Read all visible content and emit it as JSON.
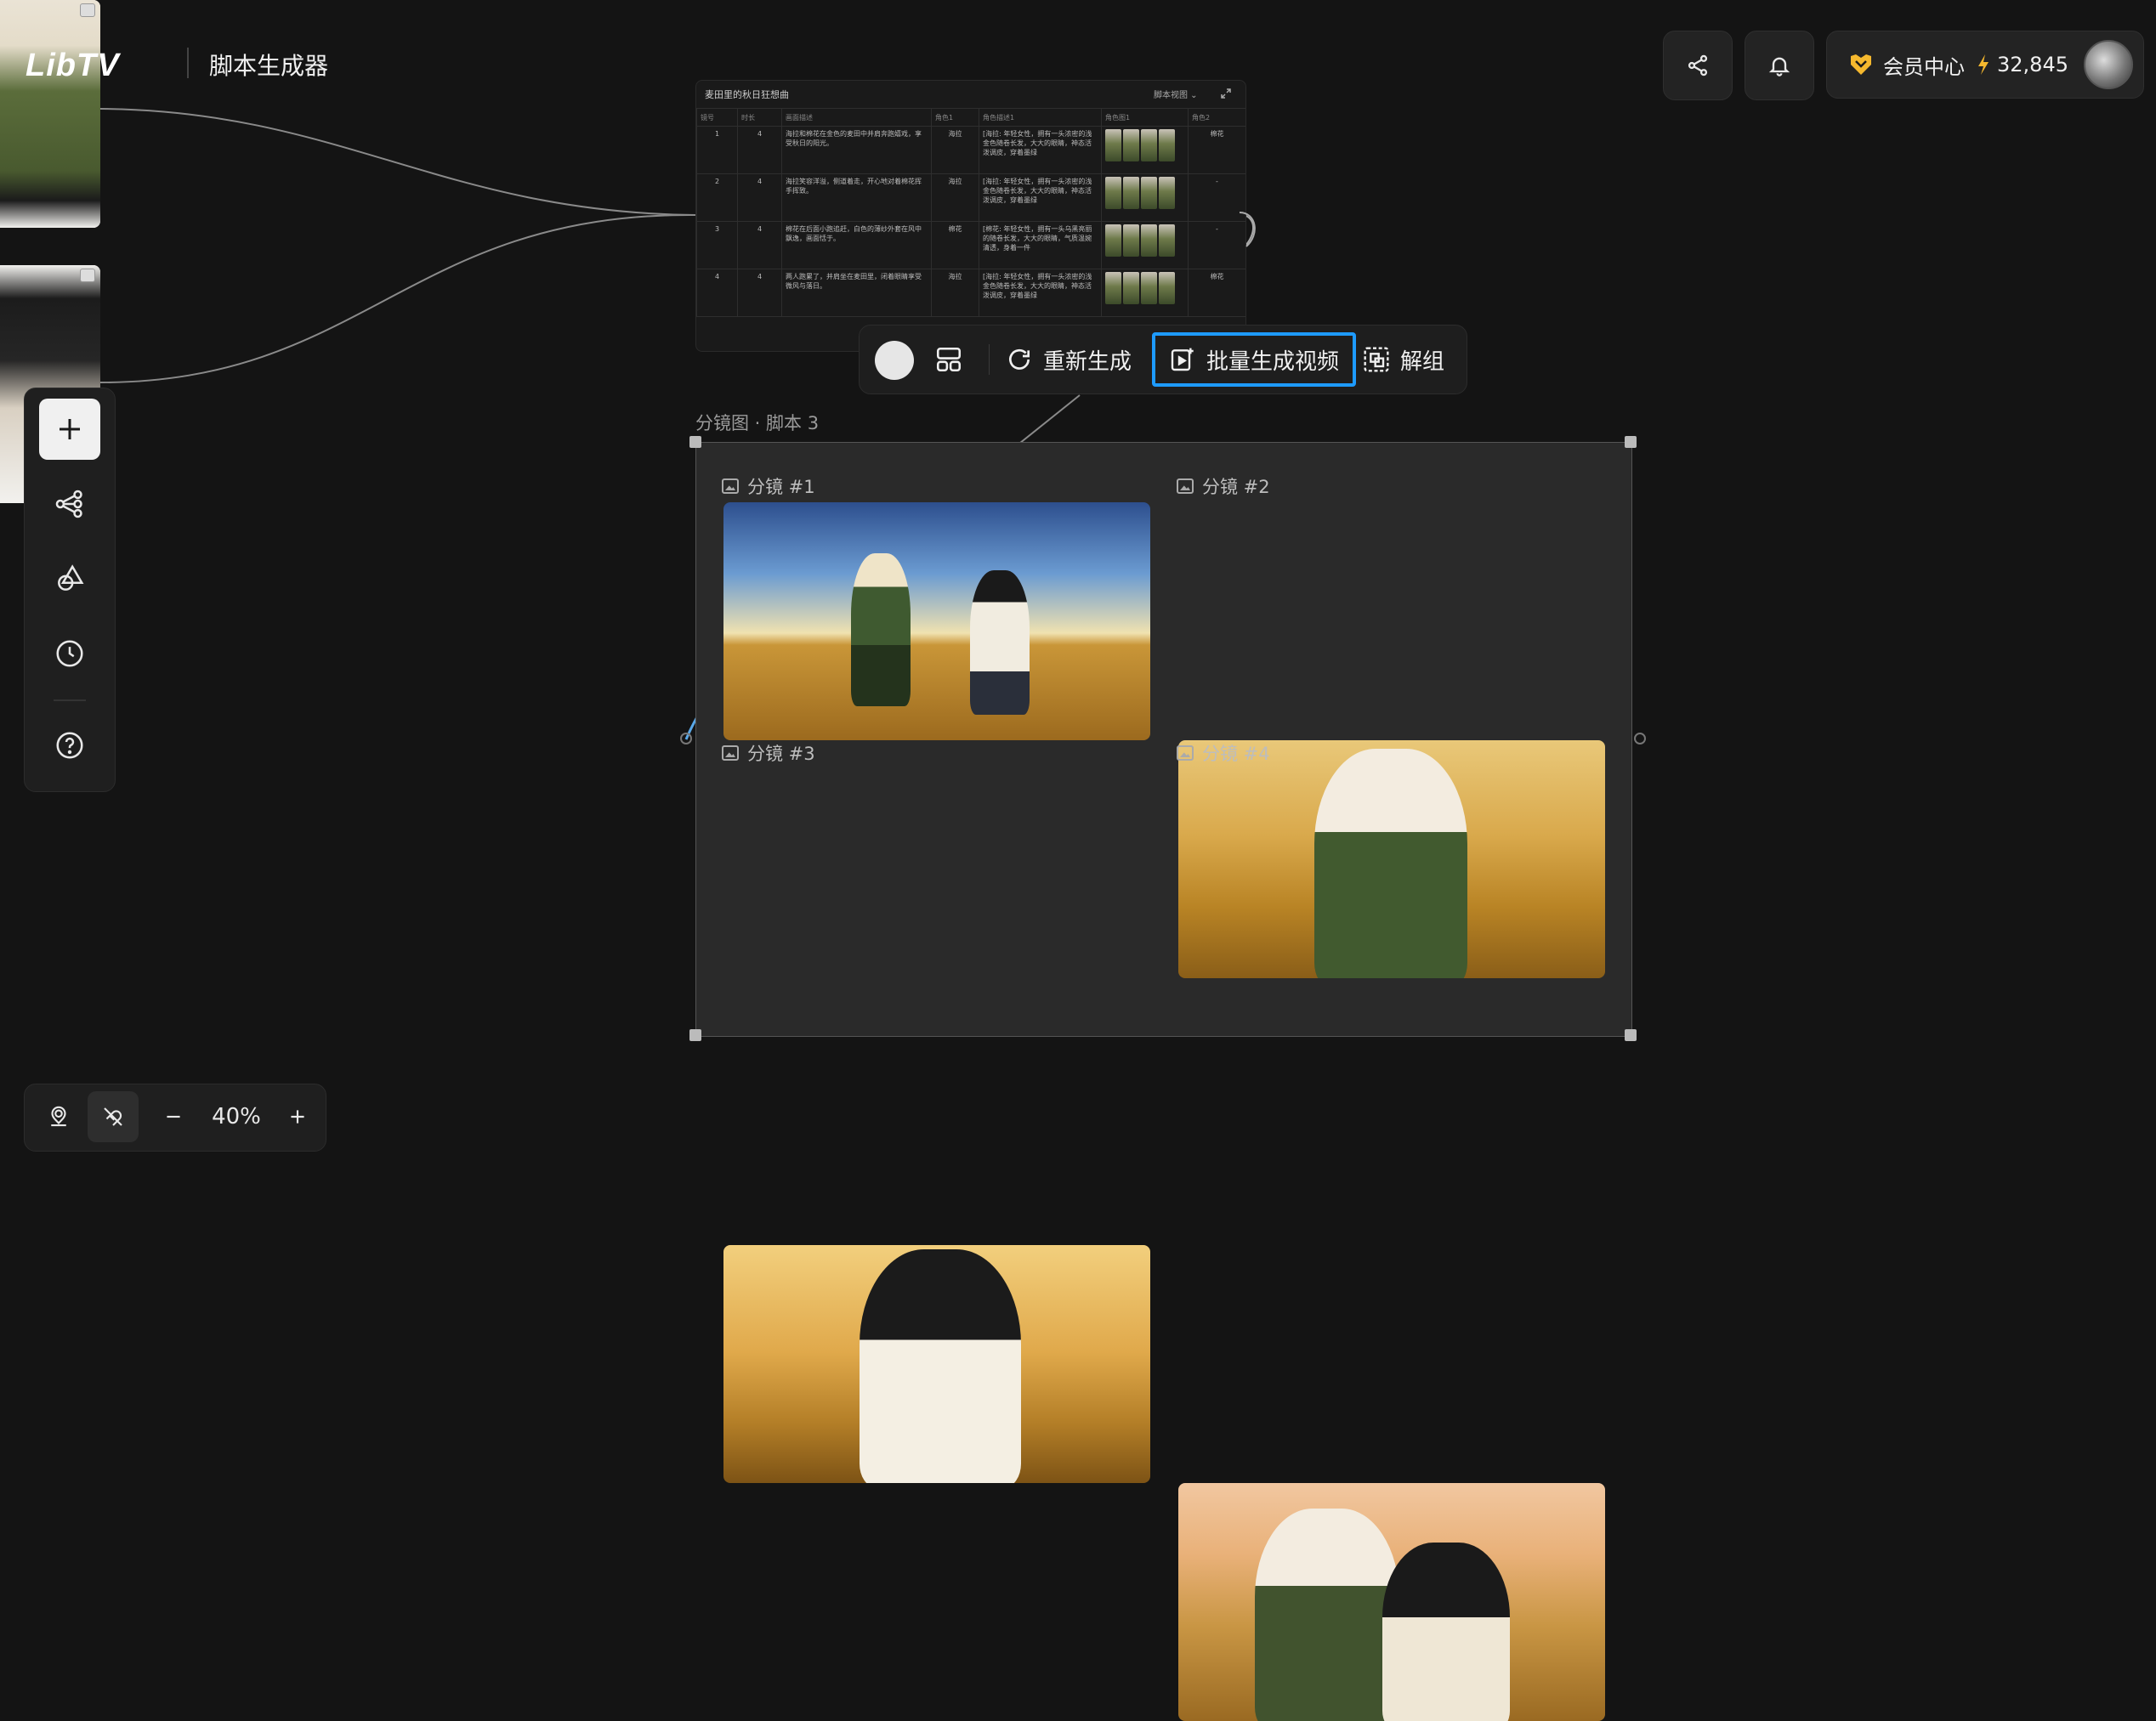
{
  "header": {
    "logo_text": "LibTV",
    "app_title": "脚本生成器",
    "member_label": "会员中心",
    "credits": "32,845",
    "share_icon": "share-icon",
    "bell_icon": "bell-icon"
  },
  "table_node": {
    "title": "麦田里的秋日狂想曲",
    "view_label": "脚本视图 ⌄",
    "columns": [
      "镜号",
      "时长",
      "画面描述",
      "角色1",
      "角色描述1",
      "角色图1",
      "角色2"
    ],
    "rows": [
      {
        "no": "1",
        "dur": "4",
        "desc": "海拉和棉花在金色的麦田中并肩奔跑嬉戏，享受秋日的阳光。",
        "role1": "海拉",
        "roledesc": "[海拉: 年轻女性，拥有一头浓密的浅金色随卷长发，大大的眼睛，神态活泼调皮，穿着墨绿",
        "role2": "棉花"
      },
      {
        "no": "2",
        "dur": "4",
        "desc": "海拉笑容洋溢，侧道着走，开心地对着棉花挥手挥致。",
        "role1": "海拉",
        "roledesc": "[海拉: 年轻女性，拥有一头浓密的浅金色随卷长发，大大的眼睛，神态活泼调皮，穿着墨绿",
        "role2": "-"
      },
      {
        "no": "3",
        "dur": "4",
        "desc": "棉花在后面小跑追赶，白色的薄纱外套在风中飘逸，画面恬于。",
        "role1": "棉花",
        "roledesc": "[棉花: 年轻女性，拥有一头乌黑亮丽的随卷长发，大大的眼睛，气质温婉清透，身着一件",
        "role2": "-"
      },
      {
        "no": "4",
        "dur": "4",
        "desc": "两人跑累了，并肩坐在麦田里，闭着眼睛享受微风与落日。",
        "role1": "海拉",
        "roledesc": "[海拉: 年轻女性，拥有一头浓密的浅金色随卷长发，大大的眼睛，神态活泼调皮，穿着墨绿",
        "role2": "棉花"
      }
    ]
  },
  "action_bar": {
    "regenerate_label": "重新生成",
    "batch_video_label": "批量生成视频",
    "ungroup_label": "解组"
  },
  "storyboard": {
    "label": "分镜图 · 脚本 3",
    "shots": [
      {
        "label": "分镜 #1"
      },
      {
        "label": "分镜 #2"
      },
      {
        "label": "分镜 #3"
      },
      {
        "label": "分镜 #4"
      }
    ]
  },
  "zoom": {
    "value": "40%"
  },
  "colors": {
    "background": "#141414",
    "highlight": "#1e9bff",
    "member_gold": "#f5b82e"
  }
}
